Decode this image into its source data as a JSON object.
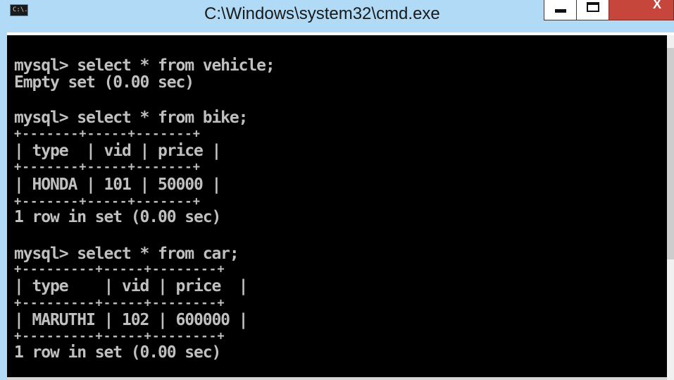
{
  "window": {
    "title": "C:\\Windows\\system32\\cmd.exe",
    "icon_label": "C:\\.",
    "icon_name": "cmd-icon",
    "close_glyph": "X",
    "colors": {
      "titlebar": "#b0daf5",
      "console_bg": "#000000",
      "console_text": "#c0c0c0",
      "close_button": "#c7463c"
    }
  },
  "console": {
    "lines": [
      "mysql> select * from vehicle;",
      "Empty set (0.00 sec)",
      "mysql> select * from bike;",
      "+-------+-----+-------+",
      "| type  | vid | price |",
      "+-------+-----+-------+",
      "| HONDA | 101 | 50000 |",
      "+-------+-----+-------+",
      "1 row in set (0.00 sec)",
      "mysql> select * from car;",
      "+---------+-----+--------+",
      "| type    | vid | price  |",
      "+---------+-----+--------+",
      "| MARUTHI | 102 | 600000 |",
      "+---------+-----+--------+",
      "1 row in set (0.00 sec)"
    ]
  }
}
